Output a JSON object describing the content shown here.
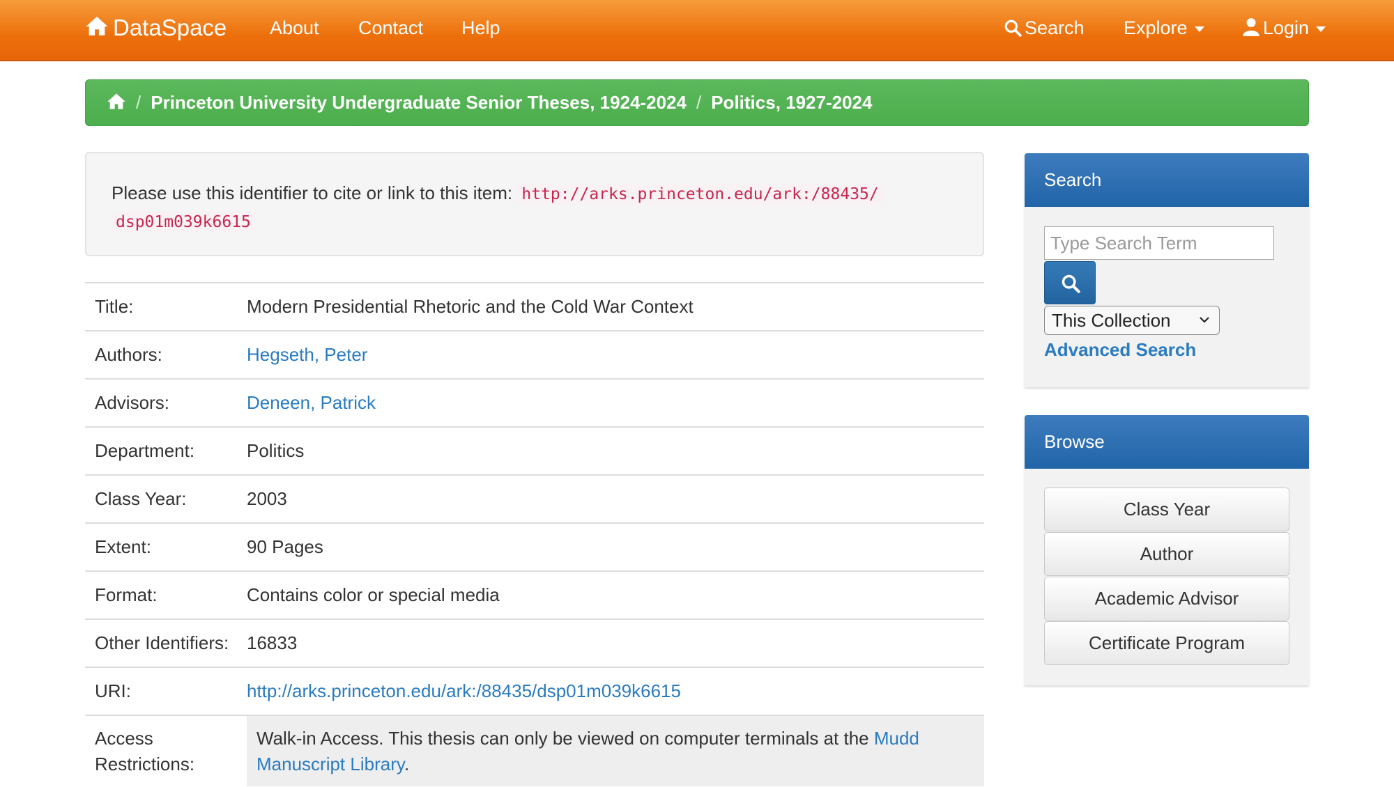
{
  "navbar": {
    "brand": "DataSpace",
    "links": [
      "About",
      "Contact",
      "Help"
    ],
    "search": "Search",
    "explore": "Explore",
    "login": "Login"
  },
  "breadcrumb": {
    "items": [
      "Princeton University Undergraduate Senior Theses, 1924-2024",
      "Politics, 1927-2024"
    ]
  },
  "citation": {
    "text": "Please use this identifier to cite or link to this item:",
    "id_line1": "http://arks.princeton.edu/ark:/88435/",
    "id_line2": "dsp01m039k6615"
  },
  "metadata": {
    "title_label": "Title:",
    "title_value": "Modern Presidential Rhetoric and the Cold War Context",
    "authors_label": "Authors:",
    "authors_value": "Hegseth, Peter",
    "advisors_label": "Advisors:",
    "advisors_value": "Deneen, Patrick",
    "department_label": "Department:",
    "department_value": "Politics",
    "class_year_label": "Class Year:",
    "class_year_value": "2003",
    "extent_label": "Extent:",
    "extent_value": "90 Pages",
    "format_label": "Format:",
    "format_value": "Contains color or special media",
    "other_ids_label": "Other Identifiers:",
    "other_ids_value": "16833",
    "uri_label": "URI:",
    "uri_value": "http://arks.princeton.edu/ark:/88435/dsp01m039k6615",
    "access_label_1": "Access",
    "access_label_2": "Restrictions:",
    "access_text": "Walk-in Access. This thesis can only be viewed on computer terminals at the ",
    "access_link": "Mudd Manuscript Library",
    "access_end": "."
  },
  "sidebar": {
    "search_heading": "Search",
    "search_placeholder": "Type Search Term",
    "scope": "This Collection",
    "advanced": "Advanced Search",
    "browse_heading": "Browse",
    "browse_items": [
      "Class Year",
      "Author",
      "Academic Advisor",
      "Certificate Program"
    ]
  },
  "colors": {
    "navbar": "#ec6f0b",
    "breadcrumb": "#5cb85c",
    "panel_heading": "#2a6db0",
    "link": "#2a7bc0",
    "code": "#c7254e"
  }
}
